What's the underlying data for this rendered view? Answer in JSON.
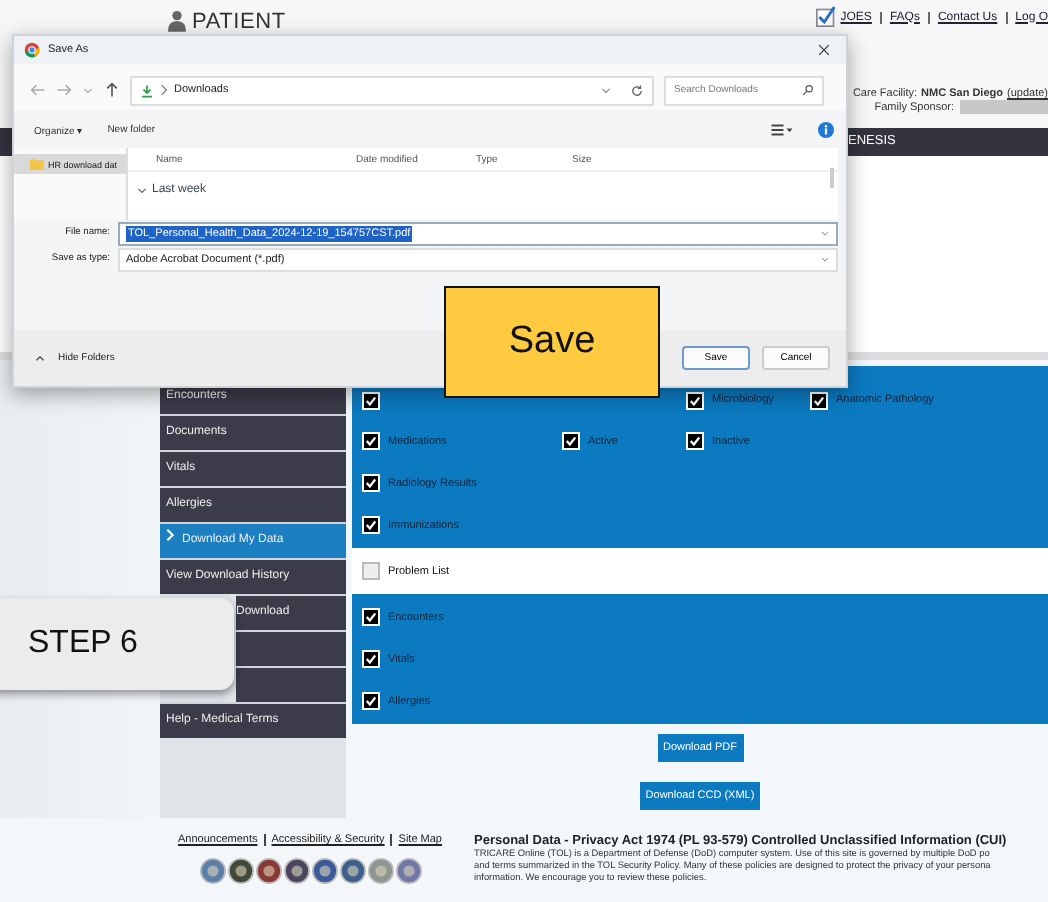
{
  "header": {
    "logo": "PATIENT",
    "links": [
      "JOES",
      "FAQs",
      "Contact Us",
      "Log O"
    ],
    "facility_label": "Care Facility:",
    "facility": "NMC San Diego",
    "facility_link": "(update)",
    "sponsor_label": "Family Sponsor:",
    "nav_label": "ENESIS"
  },
  "sidebar": {
    "items": [
      {
        "label": "Encounters",
        "selected": false
      },
      {
        "label": "Documents",
        "selected": false
      },
      {
        "label": "Vitals",
        "selected": false
      },
      {
        "label": "Allergies",
        "selected": false
      },
      {
        "label": "Download My Data",
        "selected": true
      },
      {
        "label": "View Download History",
        "selected": false
      },
      {
        "label": "Download",
        "selected": false,
        "kind": "covered"
      },
      {
        "selected": false,
        "kind": "covered"
      },
      {
        "selected": false,
        "kind": "covered"
      },
      {
        "label": "Help - Medical Terms",
        "selected": false
      }
    ]
  },
  "options": {
    "groups": [
      {
        "highlighted": true,
        "rows": [
          [
            {
              "checked": true
            },
            "",
            {
              "label": "Microbiology",
              "checked": true
            },
            {
              "label": "Anatomic Pathology",
              "checked": true
            }
          ],
          [
            {
              "label": "Medications",
              "checked": true
            },
            {
              "label": "Active",
              "checked": true
            },
            {
              "label": "Inactive",
              "checked": true
            }
          ],
          [
            {
              "label": "Radiology Results",
              "checked": true
            }
          ],
          [
            {
              "label": "Immunizations",
              "checked": true
            }
          ]
        ]
      },
      {
        "highlighted": false,
        "rows": [
          [
            {
              "label": "Problem List",
              "checked": false
            }
          ]
        ]
      },
      {
        "highlighted": true,
        "rows": [
          [
            {
              "label": "Encounters",
              "checked": true
            }
          ],
          [
            {
              "label": "Vitals",
              "checked": true
            }
          ],
          [
            {
              "label": "Allergies",
              "checked": true
            }
          ]
        ]
      }
    ],
    "buttons": [
      "Download PDF",
      "Download CCD (XML)"
    ]
  },
  "footer": {
    "links": [
      "Announcements",
      "Accessibility & Security",
      "Site Map"
    ],
    "notice_title": "Personal Data - Privacy Act 1974 (PL 93-579)  Controlled Unclassified Information (CUI)",
    "notice_lines": [
      "TRICARE Online (TOL) is a Department of Defense (DoD) computer system. Use of this site is governed by multiple DoD po",
      "and terms summarized in the TOL Security Policy. Many of these policies are designed to protect the privacy of your persona",
      "information. We encourage you to review these policies."
    ]
  },
  "dialog": {
    "title": "Save As",
    "path": "Downloads",
    "search_placeholder": "Search Downloads",
    "toolbar": [
      "Organize ▾",
      "New folder"
    ],
    "folders": [
      {
        "label": "HR download dat",
        "selected": true
      }
    ],
    "columns": [
      "Name",
      "Date modified",
      "Type",
      "Size"
    ],
    "group": "Last week",
    "file_name_label": "File name:",
    "file_name": "TOL_Personal_Health_Data_2024-12-19_154757CST.pdf",
    "type_label": "Save as type:",
    "file_type": "Adobe Acrobat Document (*.pdf)",
    "hide_folders": "Hide Folders",
    "buttons": [
      "Save",
      "Cancel"
    ]
  },
  "callouts": [
    {
      "text": "Save",
      "kind": "yellow"
    },
    {
      "text": "STEP 6",
      "kind": "grey"
    }
  ]
}
